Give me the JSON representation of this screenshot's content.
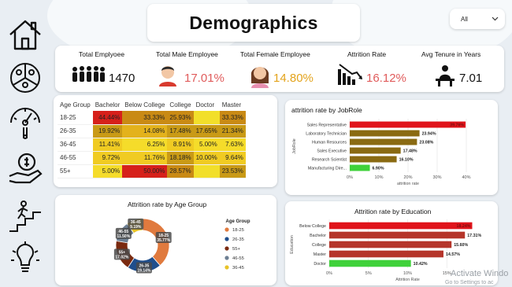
{
  "header": {
    "title": "Demographics"
  },
  "filter": {
    "selected": "All"
  },
  "sidebar": {
    "icons": [
      "home-icon",
      "pie-chart-people-icon",
      "gauge-icon",
      "money-hand-icon",
      "career-ladder-icon",
      "lightbulb-icon"
    ]
  },
  "kpis": [
    {
      "title": "Total Emplyoee",
      "value": "1470",
      "color": "#111111"
    },
    {
      "title": "Total Male Employee",
      "value": "17.01%",
      "color": "#e05b5b"
    },
    {
      "title": "Total Female Employee",
      "value": "14.80%",
      "color": "#e3a31b"
    },
    {
      "title": "Attrition Rate",
      "value": "16.12%",
      "color": "#e05b5b"
    },
    {
      "title": "Avg Tenure in Years",
      "value": "7.01",
      "color": "#111111"
    }
  ],
  "age_table": {
    "columns": [
      "Age Group",
      "Bachelor",
      "Below College",
      "College",
      "Doctor",
      "Master"
    ],
    "rows": [
      {
        "label": "18-25",
        "cells": [
          "44.44%",
          "33.33%",
          "25.93%",
          "",
          "33.33%"
        ]
      },
      {
        "label": "26-35",
        "cells": [
          "19.92%",
          "14.08%",
          "17.48%",
          "17.65%",
          "21.34%"
        ]
      },
      {
        "label": "36-45",
        "cells": [
          "11.41%",
          "6.25%",
          "8.91%",
          "5.00%",
          "7.63%"
        ]
      },
      {
        "label": "46-55",
        "cells": [
          "9.72%",
          "11.76%",
          "18.18%",
          "10.00%",
          "9.64%"
        ]
      },
      {
        "label": "55+",
        "cells": [
          "5.00%",
          "50.00%",
          "28.57%",
          "",
          "23.53%"
        ]
      }
    ]
  },
  "chart_data": [
    {
      "type": "bar",
      "orientation": "horizontal",
      "title": "attrition rate by JobRole",
      "xlabel": "attrition rate",
      "ylabel": "JobRole",
      "categories": [
        "Sales Representative",
        "Laboratory Technician",
        "Human Resources",
        "Sales Executive",
        "Research Scientist",
        "Manufacturing Dire..."
      ],
      "values": [
        39.76,
        23.94,
        23.08,
        17.48,
        16.1,
        6.9
      ],
      "value_labels": [
        "39.76%",
        "23.94%",
        "23.08%",
        "17.48%",
        "16.10%",
        "6.90%"
      ],
      "colors": [
        "#e0141b",
        "#8a6a12",
        "#8a6a12",
        "#8a6a12",
        "#8a6a12",
        "#3fd13a"
      ],
      "xticks": [
        "0%",
        "10%",
        "20%",
        "30%",
        "40%"
      ],
      "xlim": [
        0,
        40
      ]
    },
    {
      "type": "pie",
      "title": "Attrition rate by Age Group",
      "legend_title": "Age Group",
      "legend_position": "right",
      "slices": [
        {
          "name": "18-25",
          "value": 35.77,
          "label_line1": "18-25",
          "label_line2": "35.77%",
          "color": "#e07a3e"
        },
        {
          "name": "26-35",
          "value": 19.14,
          "label_line1": "26-35",
          "label_line2": "19.14%",
          "color": "#1f4e8c"
        },
        {
          "name": "55+",
          "value": 17.02,
          "label_line1": "55+",
          "label_line2": "17.02%",
          "color": "#7a2a10"
        },
        {
          "name": "46-55",
          "value": 11.5,
          "label_line1": "46-55",
          "label_line2": "11.50%",
          "color": "#6d7f93"
        },
        {
          "name": "36-45",
          "value": 9.19,
          "label_line1": "36-45",
          "label_line2": "9.19%",
          "color": "#e8c328"
        }
      ],
      "legend": [
        {
          "name": "18-25",
          "color": "#e07a3e"
        },
        {
          "name": "26-35",
          "color": "#1f4e8c"
        },
        {
          "name": "55+",
          "color": "#7a2a10"
        },
        {
          "name": "46-55",
          "color": "#6d7f93"
        },
        {
          "name": "36-45",
          "color": "#e8c328"
        }
      ]
    },
    {
      "type": "bar",
      "orientation": "horizontal",
      "title": "Attrition rate by Education",
      "xlabel": "Attrition Rate",
      "ylabel": "Education",
      "categories": [
        "Below College",
        "Bachelor",
        "College",
        "Master",
        "Doctor"
      ],
      "values": [
        18.24,
        17.31,
        15.6,
        14.57,
        10.42
      ],
      "value_labels": [
        "18.24%",
        "17.31%",
        "15.60%",
        "14.57%",
        "10.42%"
      ],
      "colors": [
        "#e0141b",
        "#b5352a",
        "#b5352a",
        "#b5352a",
        "#3fd13a"
      ],
      "xticks": [
        "0%",
        "5%",
        "10%",
        "15%"
      ],
      "xlim": [
        0,
        20
      ]
    }
  ],
  "watermark": {
    "line1": "Activate Windo",
    "line2": "Go to Settings to ac"
  }
}
